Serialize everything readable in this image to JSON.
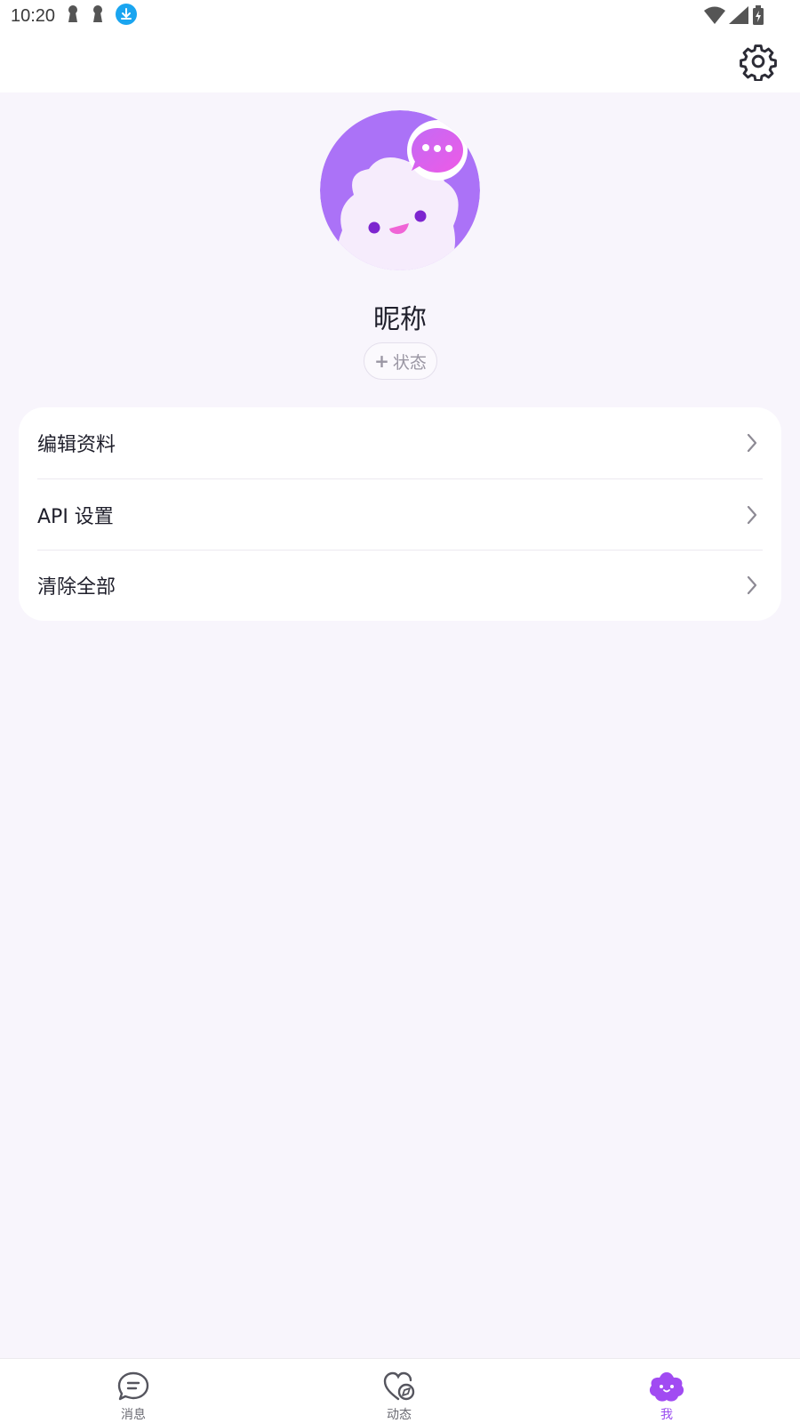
{
  "statusbar": {
    "time": "10:20",
    "left_icons": [
      "keyhole-icon",
      "keyhole-icon",
      "download-icon"
    ],
    "right_icons": [
      "wifi-icon",
      "signal-icon",
      "battery-charging-icon"
    ]
  },
  "header": {
    "settings_icon": "gear-icon"
  },
  "profile": {
    "nickname": "昵称",
    "status_plus": "+",
    "status_label": "状态"
  },
  "menu": {
    "items": [
      {
        "label": "编辑资料"
      },
      {
        "label": "API 设置"
      },
      {
        "label": "清除全部"
      }
    ]
  },
  "bottom_nav": {
    "items": [
      {
        "label": "消息",
        "icon": "chat-bubble-icon",
        "active": false
      },
      {
        "label": "动态",
        "icon": "heart-compass-icon",
        "active": false
      },
      {
        "label": "我",
        "icon": "cloud-face-icon",
        "active": true
      }
    ]
  },
  "colors": {
    "accent": "#9a4cf0",
    "page_bg": "#f8f5fc",
    "card_bg": "#ffffff",
    "text": "#1f1f2b",
    "muted": "#9a96a3"
  }
}
